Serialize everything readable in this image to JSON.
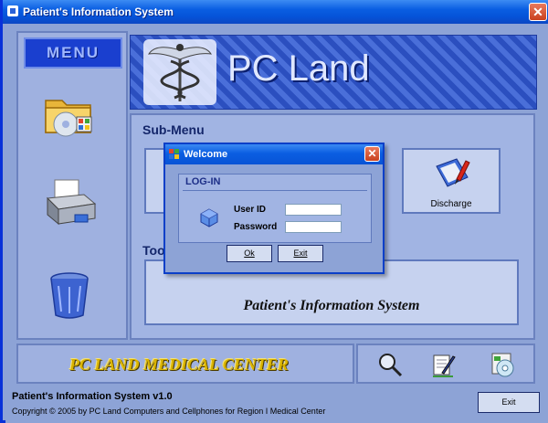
{
  "window": {
    "title": "Patient's Information System",
    "close_glyph": "✕"
  },
  "menu": {
    "button_label": "MENU",
    "icons": [
      "folder-cd-icon",
      "printer-icon",
      "recycle-bin-icon"
    ]
  },
  "banner": {
    "text": "PC Land",
    "icon": "caduceus-icon"
  },
  "submenu": {
    "heading": "Sub-Menu",
    "discharge_label": "Discharge",
    "tools_heading": "Too",
    "info_text": "Patient's Information System"
  },
  "footer": {
    "logo_text": "PC LAND MEDICAL CENTER",
    "tool_icons": [
      "magnifier-icon",
      "notepad-pen-icon",
      "cd-tools-icon"
    ]
  },
  "statusbar": {
    "app_version": "Patient's Information System v1.0",
    "copyright": "Copyright © 2005 by PC Land Computers and Cellphones for Region I Medical Center",
    "exit_label": "Exit"
  },
  "login_dialog": {
    "title": "Welcome",
    "close_glyph": "✕",
    "section_heading": "LOG-IN",
    "user_id_label": "User ID",
    "password_label": "Password",
    "user_id_value": "",
    "password_value": "",
    "ok_label": "Ok",
    "exit_label": "Exit"
  },
  "colors": {
    "titlebar": "#0a5ee2",
    "background": "#8da3d6",
    "panel": "#a1b4e3",
    "logo_gold": "#d9b300"
  }
}
